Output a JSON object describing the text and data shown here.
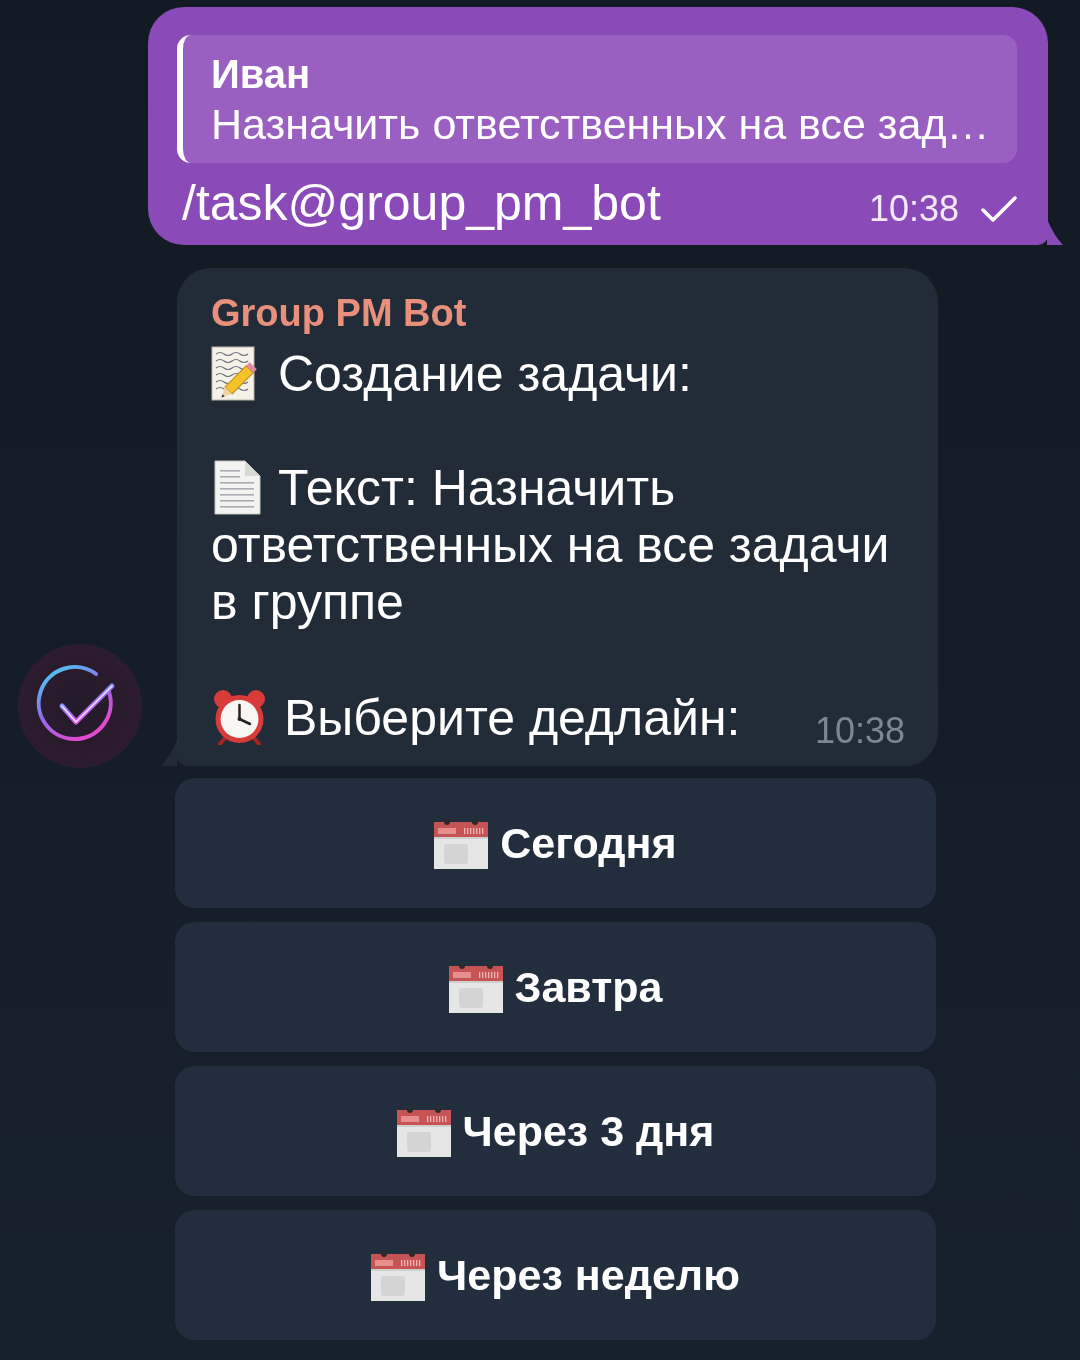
{
  "outgoing_message": {
    "reply": {
      "author": "Иван",
      "text": "Назначить ответственных на все зад…"
    },
    "text": "/task@group_pm_bot",
    "time": "10:38",
    "read": false
  },
  "bot_message": {
    "sender": "Group PM Bot",
    "paragraphs": [
      {
        "kind": "memo",
        "lines": [
          "Создание задачи:"
        ]
      },
      {
        "kind": "document",
        "lines": [
          "Текст: Назначить",
          "ответственных на все задачи",
          "в группе"
        ]
      },
      {
        "kind": "alarm",
        "lines": [
          "Выберите дедлайн:"
        ]
      }
    ],
    "time": "10:38"
  },
  "keyboard": [
    {
      "label": "Сегодня"
    },
    {
      "label": "Завтра"
    },
    {
      "label": "Через 3 дня"
    },
    {
      "label": "Через неделю"
    }
  ]
}
